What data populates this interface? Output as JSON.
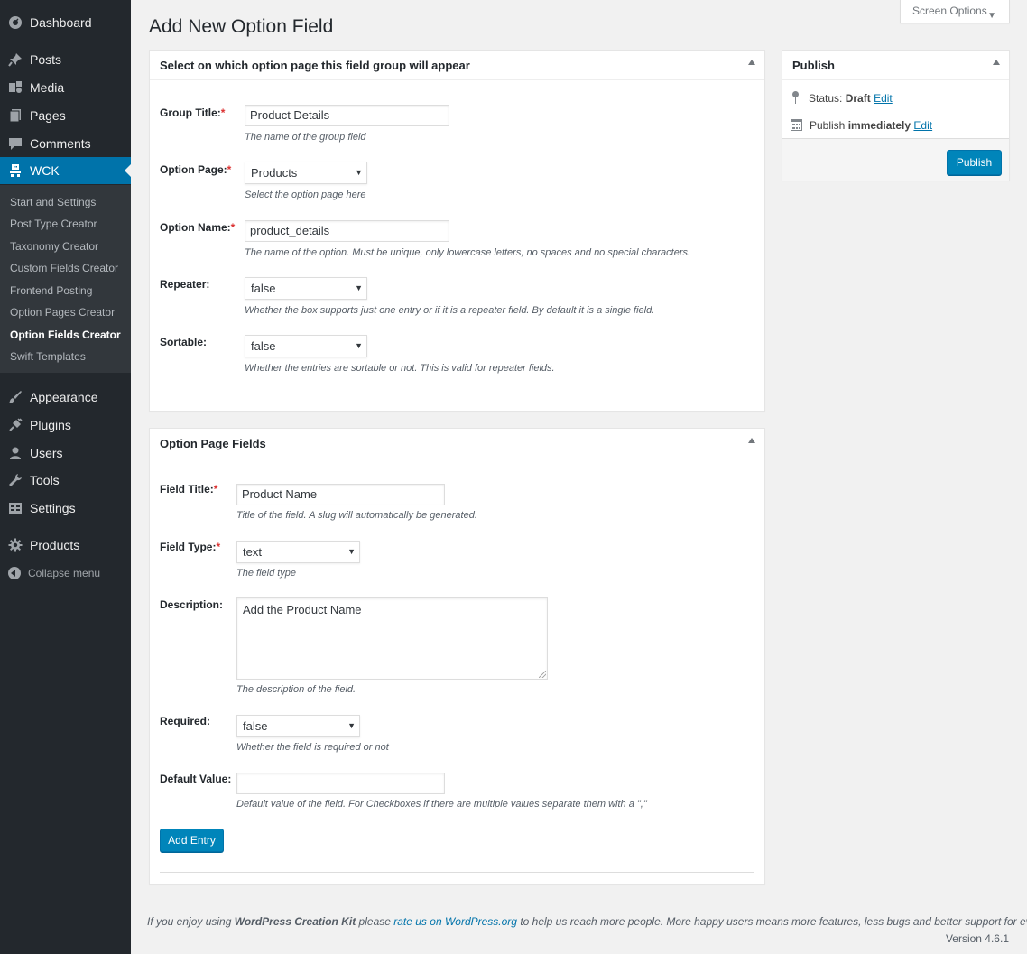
{
  "sidebar": {
    "items": [
      {
        "label": "Dashboard",
        "icon": "dashboard-icon"
      },
      {
        "label": "Posts",
        "icon": "pin-icon"
      },
      {
        "label": "Media",
        "icon": "media-icon"
      },
      {
        "label": "Pages",
        "icon": "pages-icon"
      },
      {
        "label": "Comments",
        "icon": "comment-icon"
      },
      {
        "label": "WCK",
        "icon": "wck-icon"
      },
      {
        "label": "Appearance",
        "icon": "brush-icon"
      },
      {
        "label": "Plugins",
        "icon": "plug-icon"
      },
      {
        "label": "Users",
        "icon": "user-icon"
      },
      {
        "label": "Tools",
        "icon": "wrench-icon"
      },
      {
        "label": "Settings",
        "icon": "settings-icon"
      },
      {
        "label": "Products",
        "icon": "gear-icon"
      }
    ],
    "submenu": [
      "Start and Settings",
      "Post Type Creator",
      "Taxonomy Creator",
      "Custom Fields Creator",
      "Frontend Posting",
      "Option Pages Creator",
      "Option Fields Creator",
      "Swift Templates"
    ],
    "collapse_label": "Collapse menu"
  },
  "screen_options": "Screen Options",
  "page_title": "Add New Option Field",
  "group_box": {
    "title": "Select on which option page this field group will appear",
    "fields": {
      "group_title": {
        "label": "Group Title:",
        "value": "Product Details",
        "help": "The name of the group field"
      },
      "option_page": {
        "label": "Option Page:",
        "value": "Products",
        "help": "Select the option page here"
      },
      "option_name": {
        "label": "Option Name:",
        "value": "product_details",
        "help": "The name of the option. Must be unique, only lowercase letters, no spaces and no special characters."
      },
      "repeater": {
        "label": "Repeater:",
        "value": "false",
        "help": "Whether the box supports just one entry or if it is a repeater field. By default it is a single field."
      },
      "sortable": {
        "label": "Sortable:",
        "value": "false",
        "help": "Whether the entries are sortable or not. This is valid for repeater fields."
      }
    }
  },
  "fields_box": {
    "title": "Option Page Fields",
    "fields": {
      "field_title": {
        "label": "Field Title:",
        "value": "Product Name",
        "help": "Title of the field. A slug will automatically be generated."
      },
      "field_type": {
        "label": "Field Type:",
        "value": "text",
        "help": "The field type"
      },
      "description": {
        "label": "Description:",
        "value": "Add the Product Name",
        "help": "The description of the field."
      },
      "required": {
        "label": "Required:",
        "value": "false",
        "help": "Whether the field is required or not"
      },
      "default_value": {
        "label": "Default Value:",
        "value": "",
        "help": "Default value of the field. For Checkboxes if there are multiple values separate them with a \",\""
      }
    },
    "add_entry_label": "Add Entry"
  },
  "required_mark": "*",
  "publish_box": {
    "title": "Publish",
    "status_prefix": "Status:",
    "status_value": "Draft",
    "status_edit": "Edit",
    "publish_prefix": "Publish",
    "publish_value": "immediately",
    "publish_edit": "Edit",
    "button_label": "Publish"
  },
  "footer": {
    "text_before": "If you enjoy using ",
    "brand": "WordPress Creation Kit",
    "text_mid": " please ",
    "link": "rate us on WordPress.org",
    "text_after": " to help us reach more people. More happy users means more features, less bugs and better support for everyone.",
    "version": "Version 4.6.1"
  },
  "colors": {
    "sidebar_bg": "#23282d",
    "submenu_bg": "#32373c",
    "accent": "#0073aa",
    "primary_button": "#0085ba",
    "required": "#dc3232"
  }
}
